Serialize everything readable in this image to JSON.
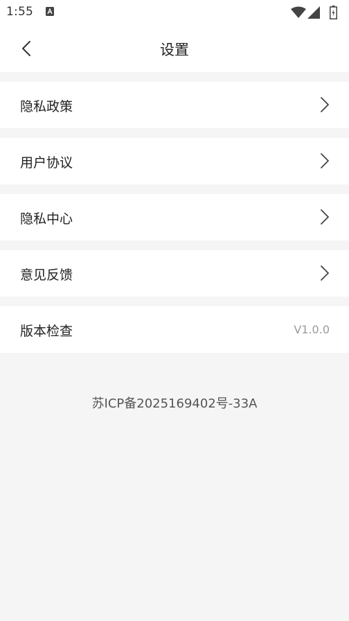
{
  "status_bar": {
    "time": "1:55",
    "icons": [
      "a-badge-icon",
      "wifi-icon",
      "signal-icon",
      "battery-charging-icon"
    ]
  },
  "header": {
    "title": "设置",
    "back_icon": "chevron-left-icon"
  },
  "settings": {
    "items": [
      {
        "label": "隐私政策",
        "icon": "chevron-right-icon"
      },
      {
        "label": "用户协议",
        "icon": "chevron-right-icon"
      },
      {
        "label": "隐私中心",
        "icon": "chevron-right-icon"
      },
      {
        "label": "意见反馈",
        "icon": "chevron-right-icon"
      },
      {
        "label": "版本检查",
        "value": "V1.0.0"
      }
    ]
  },
  "footer": {
    "icp": "苏ICP备2025169402号-33A"
  },
  "colors": {
    "background": "#f5f5f5",
    "surface": "#ffffff",
    "text": "#222222",
    "secondary_text": "#9a9a9a",
    "chevron": "#444444"
  }
}
